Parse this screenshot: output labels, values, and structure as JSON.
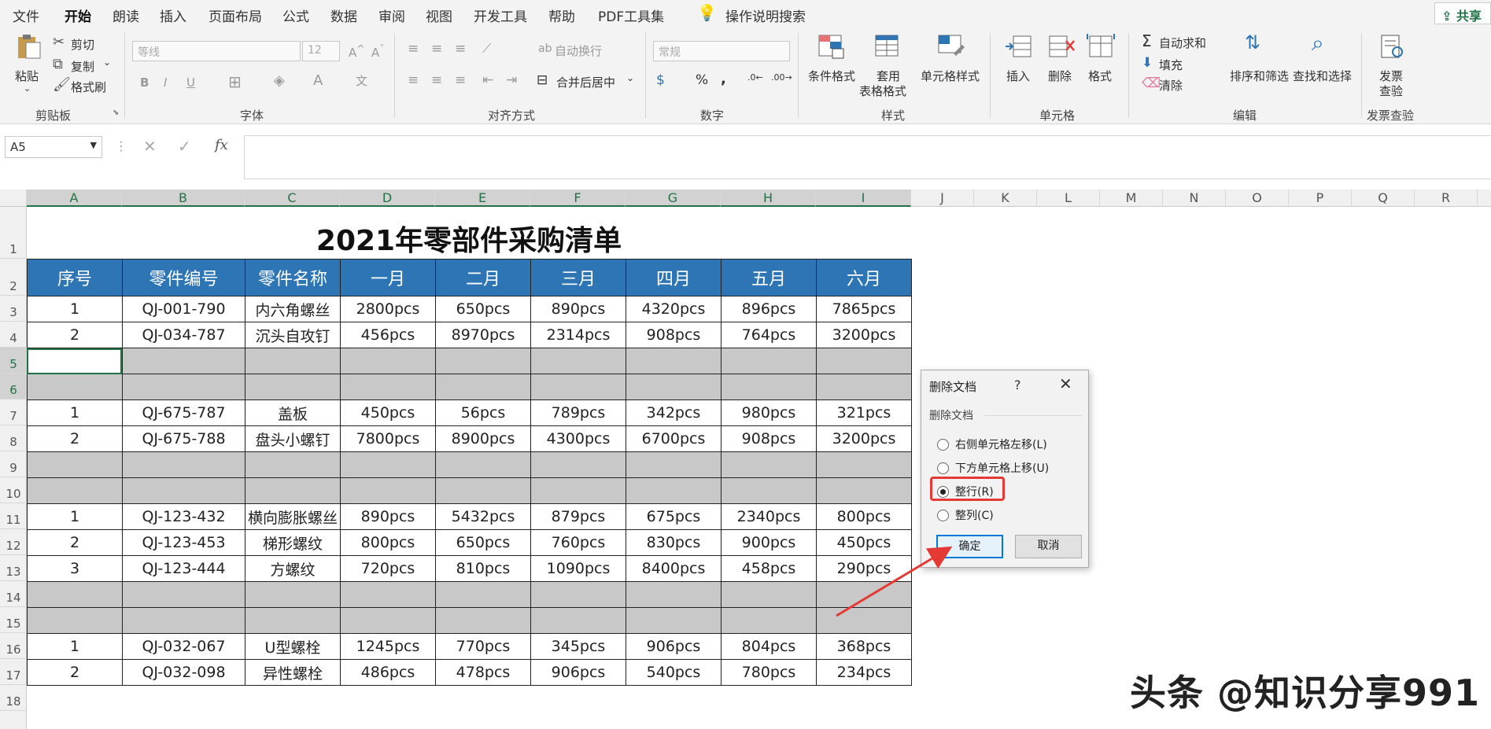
{
  "menu": {
    "items": [
      "文件",
      "开始",
      "朗读",
      "插入",
      "页面布局",
      "公式",
      "数据",
      "审阅",
      "视图",
      "开发工具",
      "帮助",
      "PDF工具集"
    ],
    "active": "开始",
    "search": "操作说明搜索",
    "share": "共享"
  },
  "ribbon": {
    "clipboard": {
      "paste": "粘贴",
      "cut": "剪切",
      "copy": "复制",
      "format_painter": "格式刷",
      "label": "剪贴板"
    },
    "font": {
      "font_name": "等线",
      "font_size": "12",
      "bold": "B",
      "italic": "I",
      "underline": "U",
      "label": "字体"
    },
    "alignment": {
      "wrap": "自动换行",
      "merge": "合并后居中",
      "label": "对齐方式"
    },
    "number": {
      "format": "常规",
      "percent": "%",
      "comma": ",",
      "label": "数字"
    },
    "styles": {
      "conditional": "条件格式",
      "table_1": "套用",
      "table_2": "表格格式",
      "cell_styles": "单元格样式",
      "label": "样式"
    },
    "cells": {
      "insert": "插入",
      "delete": "删除",
      "format": "格式",
      "label": "单元格"
    },
    "editing": {
      "autosum": "自动求和",
      "fill": "填充",
      "clear": "清除",
      "sort": "排序和筛选",
      "find": "查找和选择",
      "label": "编辑"
    },
    "invoice": {
      "line1": "发票",
      "line2": "查验",
      "label": "发票查验"
    }
  },
  "formula_bar": {
    "name_box": "A5",
    "fx": "fx"
  },
  "columns": [
    "A",
    "B",
    "C",
    "D",
    "E",
    "F",
    "G",
    "H",
    "I",
    "J",
    "K",
    "L",
    "M",
    "N",
    "O",
    "P",
    "Q",
    "R"
  ],
  "rows": [
    "1",
    "2",
    "3",
    "4",
    "5",
    "6",
    "7",
    "8",
    "9",
    "10",
    "11",
    "12",
    "13",
    "14",
    "15",
    "16",
    "17",
    "18"
  ],
  "sheet": {
    "title": "2021年零部件采购清单",
    "headers": [
      "序号",
      "零件编号",
      "零件名称",
      "一月",
      "二月",
      "三月",
      "四月",
      "五月",
      "六月"
    ],
    "data_rows": [
      [
        "1",
        "QJ-001-790",
        "内六角螺丝",
        "2800pcs",
        "650pcs",
        "890pcs",
        "4320pcs",
        "896pcs",
        "7865pcs"
      ],
      [
        "2",
        "QJ-034-787",
        "沉头自攻钉",
        "456pcs",
        "8970pcs",
        "2314pcs",
        "908pcs",
        "764pcs",
        "3200pcs"
      ],
      null,
      null,
      [
        "1",
        "QJ-675-787",
        "盖板",
        "450pcs",
        "56pcs",
        "789pcs",
        "342pcs",
        "980pcs",
        "321pcs"
      ],
      [
        "2",
        "QJ-675-788",
        "盘头小螺钉",
        "7800pcs",
        "8900pcs",
        "4300pcs",
        "6700pcs",
        "908pcs",
        "3200pcs"
      ],
      null,
      null,
      [
        "1",
        "QJ-123-432",
        "横向膨胀螺丝",
        "890pcs",
        "5432pcs",
        "879pcs",
        "675pcs",
        "2340pcs",
        "800pcs"
      ],
      [
        "2",
        "QJ-123-453",
        "梯形螺纹",
        "800pcs",
        "650pcs",
        "760pcs",
        "830pcs",
        "900pcs",
        "450pcs"
      ],
      [
        "3",
        "QJ-123-444",
        "方螺纹",
        "720pcs",
        "810pcs",
        "1090pcs",
        "8400pcs",
        "458pcs",
        "290pcs"
      ],
      null,
      null,
      [
        "1",
        "QJ-032-067",
        "U型螺栓",
        "1245pcs",
        "770pcs",
        "345pcs",
        "906pcs",
        "804pcs",
        "368pcs"
      ],
      [
        "2",
        "QJ-032-098",
        "异性螺栓",
        "486pcs",
        "478pcs",
        "906pcs",
        "540pcs",
        "780pcs",
        "234pcs"
      ]
    ]
  },
  "dialog": {
    "title": "删除文档",
    "help": "?",
    "close": "✕",
    "group_label": "删除文档",
    "options": [
      "右侧单元格左移(L)",
      "下方单元格上移(U)",
      "整行(R)",
      "整列(C)"
    ],
    "selected_option": "整行(R)",
    "ok": "确定",
    "cancel": "取消"
  },
  "watermark": "头条 @知识分享991",
  "colors": {
    "header_blue": "#2e75b6",
    "excel_green": "#217346",
    "blank_gray": "#c8c8c8",
    "highlight_red": "#e53935"
  }
}
